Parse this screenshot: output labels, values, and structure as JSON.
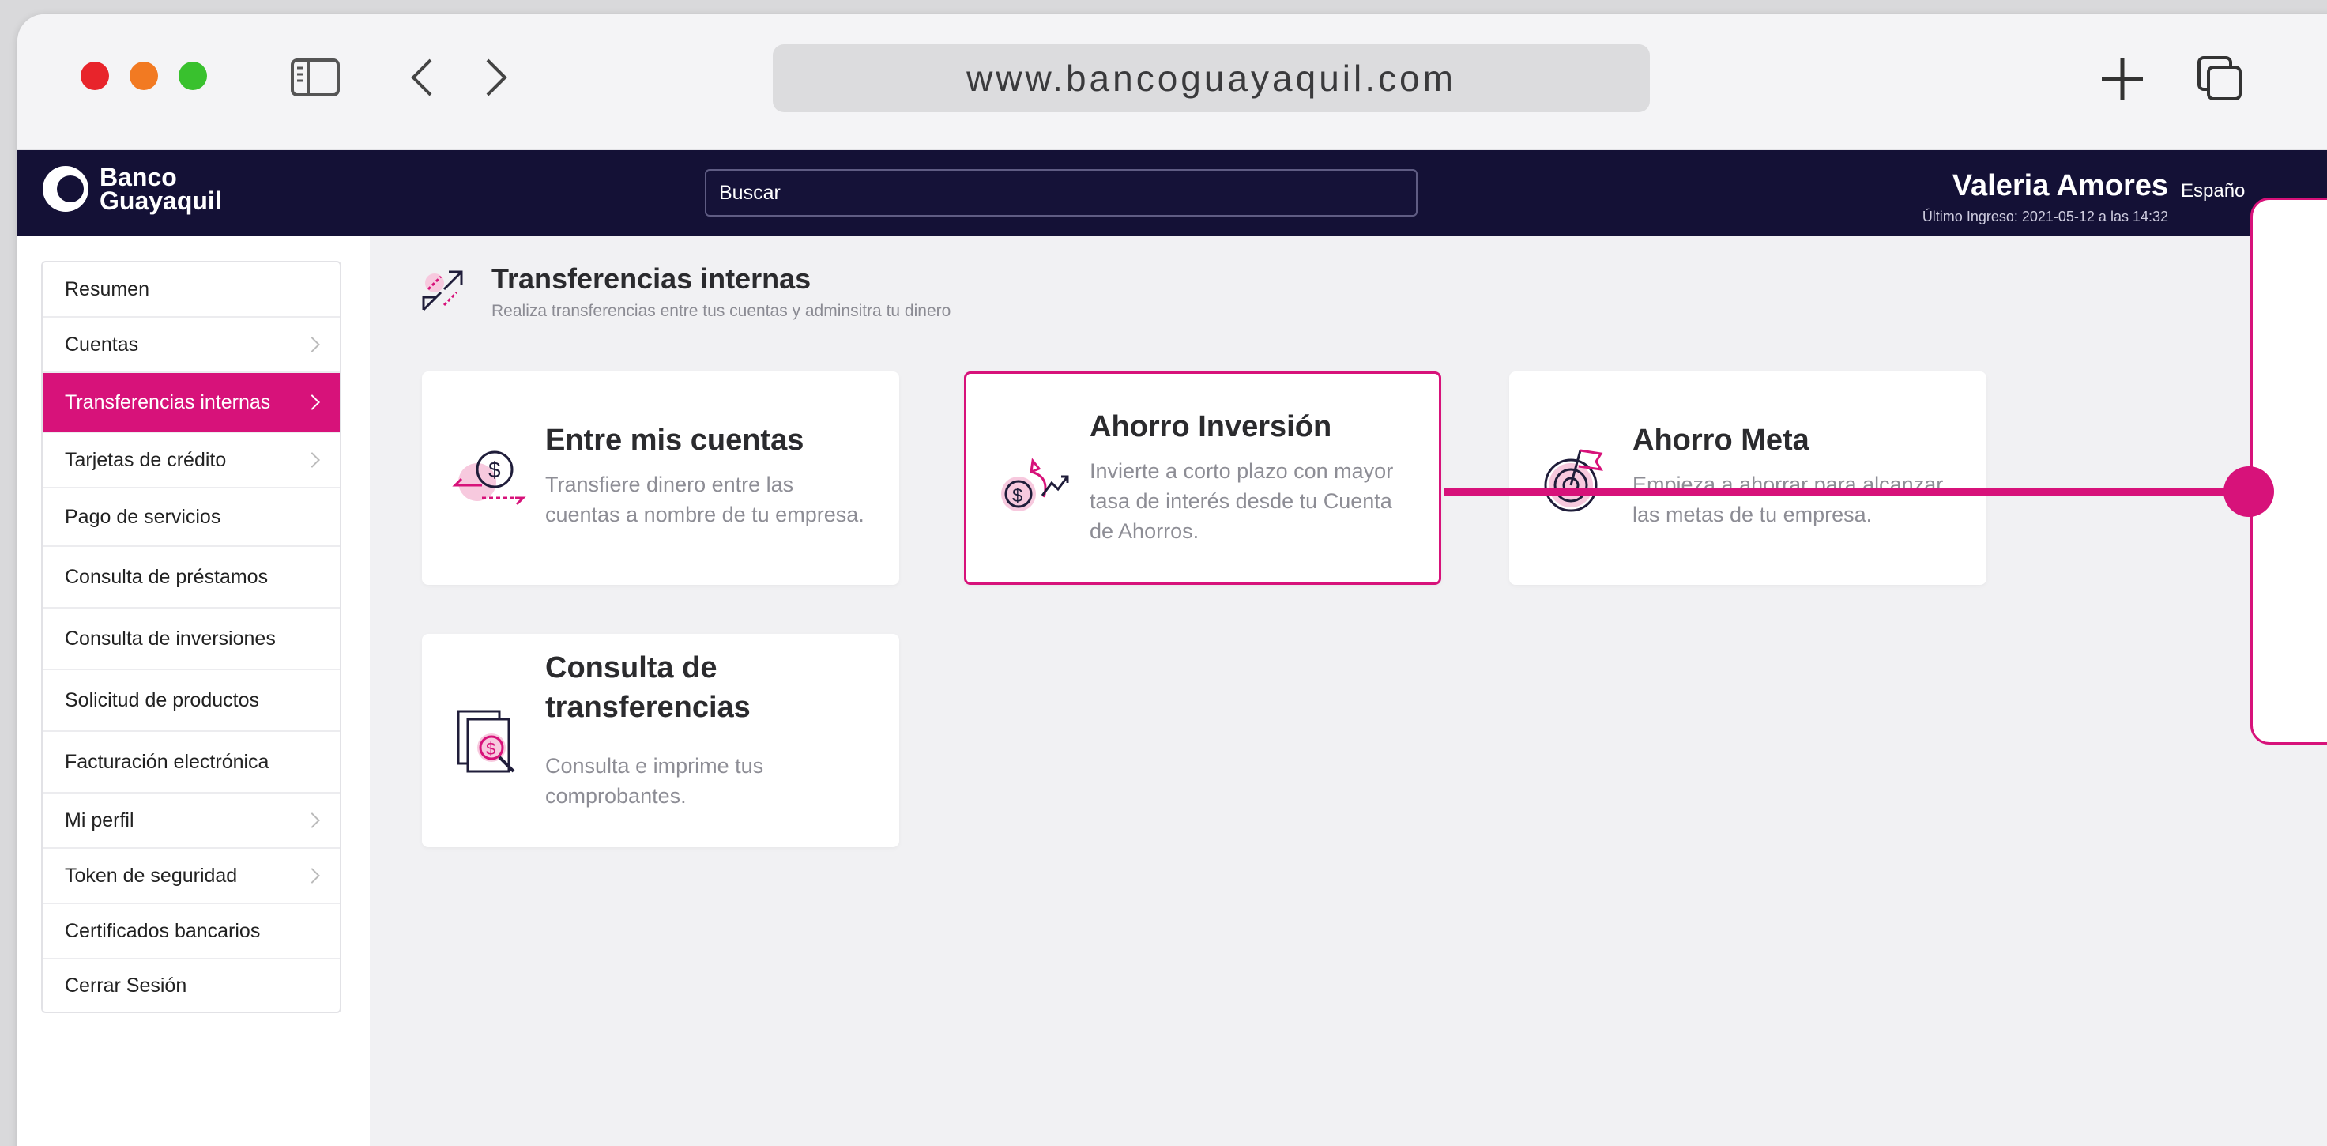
{
  "browser": {
    "url": "www.bancoguayaquil.com"
  },
  "header": {
    "logo_line1": "Banco",
    "logo_line2": "Guayaquil",
    "search_placeholder": "Buscar",
    "user_name": "Valeria Amores",
    "last_login": "Último Ingreso: 2021-05-12 a las 14:32",
    "language": "Españo"
  },
  "sidebar": {
    "items": [
      {
        "label": "Resumen",
        "chevron": false
      },
      {
        "label": "Cuentas",
        "chevron": true
      },
      {
        "label": "Transferencias internas",
        "chevron": true,
        "active": true
      },
      {
        "label": "Tarjetas de crédito",
        "chevron": true
      },
      {
        "label": "Pago de servicios",
        "chevron": false
      },
      {
        "label": "Consulta de préstamos",
        "chevron": false
      },
      {
        "label": "Consulta de inversiones",
        "chevron": false
      },
      {
        "label": "Solicitud de productos",
        "chevron": false
      },
      {
        "label": "Facturación electrónica",
        "chevron": false
      },
      {
        "label": "Mi perfil",
        "chevron": true
      },
      {
        "label": "Token de seguridad",
        "chevron": true
      },
      {
        "label": "Certificados bancarios",
        "chevron": false
      },
      {
        "label": "Cerrar Sesión",
        "chevron": false
      }
    ]
  },
  "main": {
    "title": "Transferencias internas",
    "subtitle": "Realiza transferencias entre tus cuentas y adminsitra tu dinero",
    "cards": [
      {
        "title": "Entre mis cuentas",
        "description_lines": [
          "Transfiere dinero entre las",
          "cuentas a nombre de tu empresa."
        ],
        "icon": "transfer-dollar-icon"
      },
      {
        "title": "Ahorro Inversión",
        "description_lines": [
          "Invierte a corto plazo con mayor",
          "tasa de interés desde tu Cuenta",
          "de Ahorros."
        ],
        "icon": "money-bag-growth-icon",
        "selected": true
      },
      {
        "title": "Ahorro Meta",
        "description_lines": [
          "Empieza a ahorrar para alcanzar",
          "las metas de tu empresa."
        ],
        "icon": "target-flag-icon"
      },
      {
        "title_lines": [
          "Consulta de",
          "transferencias"
        ],
        "description_lines": [
          "Consulta e imprime tus",
          "comprobantes."
        ],
        "icon": "receipt-search-icon"
      }
    ]
  },
  "colors": {
    "accent": "#d7127a",
    "header_bg": "#141136"
  }
}
